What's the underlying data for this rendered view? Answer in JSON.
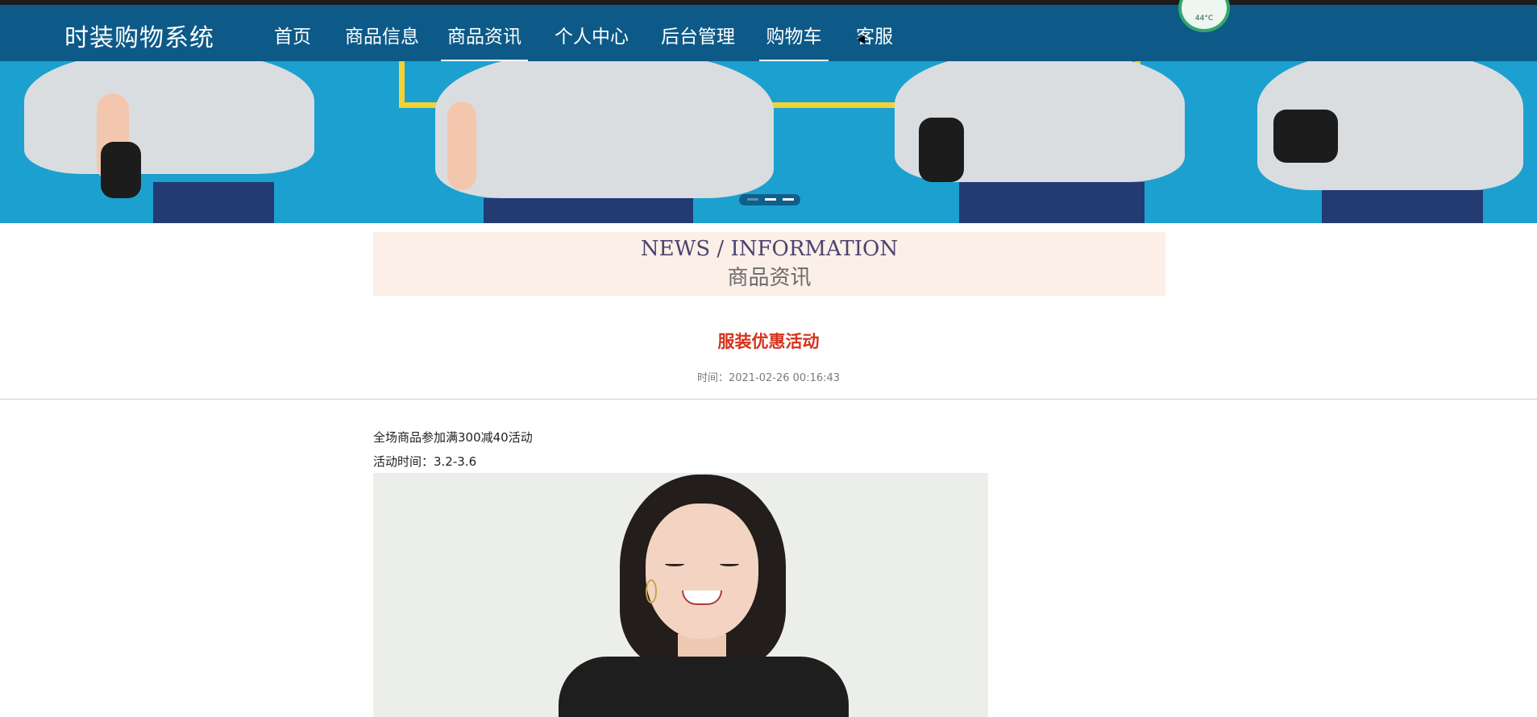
{
  "header": {
    "brand": "时装购物系统",
    "nav": [
      {
        "label": "首页",
        "active": false
      },
      {
        "label": "商品信息",
        "active": false
      },
      {
        "label": "商品资讯",
        "active": true
      },
      {
        "label": "个人中心",
        "active": false
      },
      {
        "label": "后台管理",
        "active": false
      },
      {
        "label": "购物车",
        "active": true
      },
      {
        "label": "客服",
        "active": false
      }
    ],
    "widget_temp": "44°C"
  },
  "banner": {
    "slide_count": 3
  },
  "news": {
    "title_en": "NEWS / INFORMATION",
    "title_cn": "商品资讯"
  },
  "article": {
    "title": "服装优惠活动",
    "time_label": "时间：",
    "time": "2021-02-26 00:16:43",
    "lines": [
      "全场商品参加满300减40活动",
      "活动时间：3.2-3.6"
    ]
  },
  "colors": {
    "nav_bg": "#0d5a88",
    "banner_bg": "#1ca0d0",
    "article_title": "#d7321b",
    "news_bg": "#fcefe7"
  }
}
